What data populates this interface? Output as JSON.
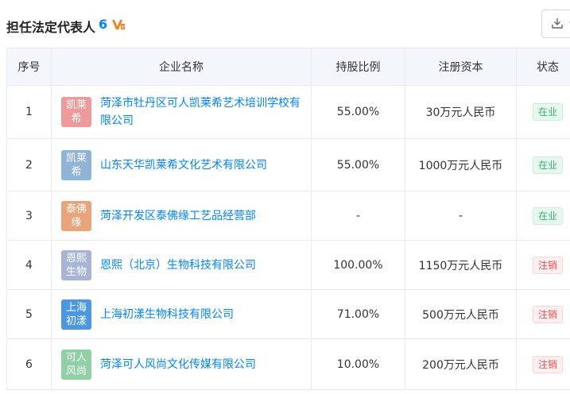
{
  "section": {
    "title": "担任法定代表人",
    "count": "6",
    "vip_icon": "vip-icon",
    "export_icon": "download-icon"
  },
  "table": {
    "headers": {
      "index": "序号",
      "company": "企业名称",
      "share": "持股比例",
      "capital": "注册资本",
      "status": "状态"
    },
    "rows": [
      {
        "index": "1",
        "logo": "凯莱希",
        "logo_color": "#ef9a9a",
        "name": "菏泽市牡丹区可人凯莱希艺术培训学校有限公司",
        "share": "55.00%",
        "capital": "30万元人民币",
        "status": "在业",
        "status_type": "active"
      },
      {
        "index": "2",
        "logo": "凯莱希",
        "logo_color": "#8fb4d8",
        "name": "山东天华凯莱希文化艺术有限公司",
        "share": "55.00%",
        "capital": "1000万元人民币",
        "status": "在业",
        "status_type": "active"
      },
      {
        "index": "3",
        "logo": "泰佛缘",
        "logo_color": "#e9a479",
        "name": "菏泽开发区泰佛缘工艺品经营部",
        "share": "-",
        "capital": "-",
        "status": "在业",
        "status_type": "active"
      },
      {
        "index": "4",
        "logo": "恩熙生物",
        "logo_color": "#a7b4d6",
        "name": "恩熙（北京）生物科技有限公司",
        "share": "100.00%",
        "capital": "1150万元人民币",
        "status": "注销",
        "status_type": "cancelled"
      },
      {
        "index": "5",
        "logo": "上海初漾",
        "logo_color": "#4b97e0",
        "name": "上海初漾生物科技有限公司",
        "share": "71.00%",
        "capital": "500万元人民币",
        "status": "注销",
        "status_type": "cancelled"
      },
      {
        "index": "6",
        "logo": "可人风尚",
        "logo_color": "#8fd0a5",
        "name": "菏泽可人风尚文化传媒有限公司",
        "share": "10.00%",
        "capital": "200万元人民币",
        "status": "注销",
        "status_type": "cancelled"
      }
    ]
  }
}
